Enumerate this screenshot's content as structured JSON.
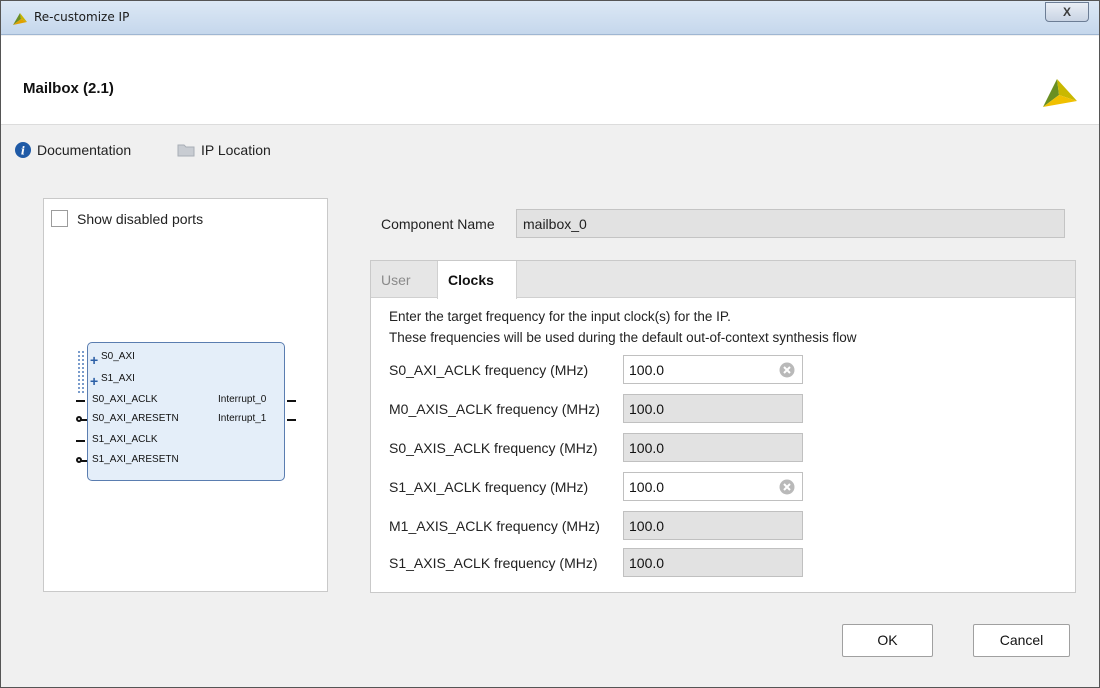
{
  "window": {
    "title": "Re-customize IP",
    "close_glyph": "X"
  },
  "header": {
    "ip_title": "Mailbox (2.1)",
    "logo_icon": "xilinx-logo"
  },
  "links": [
    {
      "label": "Documentation",
      "icon": "info-icon"
    },
    {
      "label": "IP Location",
      "icon": "folder-icon"
    }
  ],
  "symbol": {
    "show_disabled_label": "Show disabled ports",
    "show_disabled_checked": false,
    "left_ports": [
      "S0_AXI",
      "S1_AXI",
      "S0_AXI_ACLK",
      "S0_AXI_ARESETN",
      "S1_AXI_ACLK",
      "S1_AXI_ARESETN"
    ],
    "right_ports": [
      "Interrupt_0",
      "Interrupt_1"
    ]
  },
  "component": {
    "label": "Component Name",
    "value": "mailbox_0"
  },
  "tabs": [
    {
      "label": "User",
      "active": false
    },
    {
      "label": "Clocks",
      "active": true
    }
  ],
  "clocks": {
    "desc_line1": "Enter the target frequency for the input clock(s) for the IP.",
    "desc_line2": "These frequencies will be used during the default out-of-context synthesis flow",
    "fields": [
      {
        "label": "S0_AXI_ACLK frequency (MHz)",
        "value": "100.0",
        "editable": true
      },
      {
        "label": "M0_AXIS_ACLK frequency (MHz)",
        "value": "100.0",
        "editable": false
      },
      {
        "label": "S0_AXIS_ACLK frequency (MHz)",
        "value": "100.0",
        "editable": false
      },
      {
        "label": "S1_AXI_ACLK frequency (MHz)",
        "value": "100.0",
        "editable": true
      },
      {
        "label": "M1_AXIS_ACLK frequency (MHz)",
        "value": "100.0",
        "editable": false
      },
      {
        "label": "S1_AXIS_ACLK frequency (MHz)",
        "value": "100.0",
        "editable": false
      }
    ]
  },
  "buttons": {
    "ok": "OK",
    "cancel": "Cancel"
  },
  "colors": {
    "titlebar": "#c5d7ec",
    "block_fill": "#e4eef9",
    "block_border": "#5a7db0",
    "info_blue": "#1f5aa6"
  }
}
